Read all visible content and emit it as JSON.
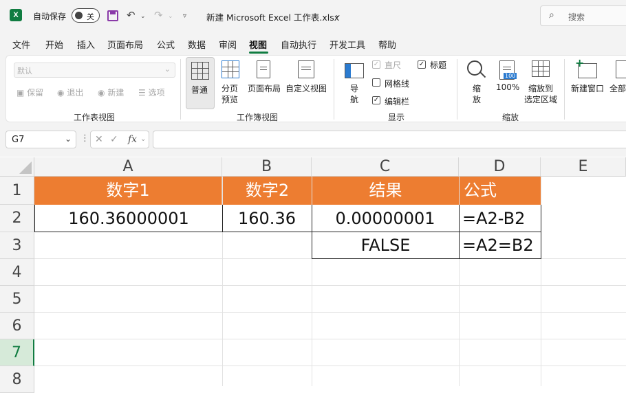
{
  "titlebar": {
    "app_logo": "X",
    "autosave_label": "自动保存",
    "autosave_state": "关",
    "document_title": "新建 Microsoft Excel 工作表.xlsx",
    "search_placeholder": "搜索"
  },
  "menu": {
    "tabs": [
      "文件",
      "开始",
      "插入",
      "页面布局",
      "公式",
      "数据",
      "审阅",
      "视图",
      "自动执行",
      "开发工具",
      "帮助"
    ],
    "active_tab": "视图"
  },
  "ribbon": {
    "sheet_view": {
      "select_value": "默认",
      "keep_label": "保留",
      "exit_label": "退出",
      "new_label": "新建",
      "options_label": "选项",
      "group_label": "工作表视图"
    },
    "workbook_view": {
      "normal_label": "普通",
      "page_break_line1": "分页",
      "page_break_line2": "预览",
      "page_layout_label": "页面布局",
      "custom_view_label": "自定义视图",
      "group_label": "工作簿视图"
    },
    "show": {
      "navigation_line1": "导",
      "navigation_line2": "航",
      "ruler_label": "直尺",
      "ruler_checked": true,
      "gridlines_label": "网格线",
      "gridlines_checked": false,
      "formula_bar_label": "编辑栏",
      "formula_bar_checked": true,
      "headings_label": "标题",
      "headings_checked": true,
      "group_label": "显示"
    },
    "zoom": {
      "zoom_line1": "缩",
      "zoom_line2": "放",
      "hundred_label": "100%",
      "hundred_icon_text": "100",
      "selection_line1": "缩放到",
      "selection_line2": "选定区域",
      "group_label": "缩放"
    },
    "window": {
      "new_window_label": "新建窗口",
      "arrange_all_label": "全部"
    }
  },
  "formula_bar": {
    "name_box": "G7",
    "fx_label": "fx",
    "formula": ""
  },
  "sheet": {
    "columns": [
      "A",
      "B",
      "C",
      "D",
      "E"
    ],
    "rows": [
      "1",
      "2",
      "3",
      "4",
      "5",
      "6",
      "7",
      "8"
    ],
    "selected_row": "7",
    "header_fill": "#ed7d31",
    "cells": {
      "A1": "数字1",
      "B1": "数字2",
      "C1": "结果",
      "D1": "公式",
      "A2": "160.36000001",
      "B2": "160.36",
      "C2": "0.00000001",
      "D2": "=A2-B2",
      "C3": "FALSE",
      "D3": "=A2=B2"
    }
  },
  "icons": [
    "excel-logo",
    "save-icon",
    "undo-icon",
    "redo-icon",
    "customize-qat-icon",
    "search-icon",
    "cancel-x-icon",
    "enter-check-icon",
    "function-icon"
  ]
}
